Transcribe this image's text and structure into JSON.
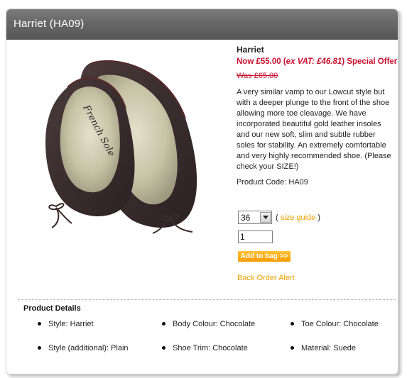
{
  "window": {
    "title": "Harriet (HA09)"
  },
  "product": {
    "name": "Harriet",
    "price_now_prefix": "Now £55.00 (",
    "price_vat": "ex VAT: £46.81",
    "price_now_suffix": ") Special Offer",
    "price_was": "Was £65.00",
    "description": "A very similar vamp to our Lowcut style but with a deeper plunge to the front of the shoe allowing more toe cleavage. We have incorporated beautiful gold leather insoles and our new soft, slim and subtle rubber soles for stability. An extremely comfortable and very highly recommended shoe. (Please check your SIZE!)",
    "code": "Product Code: HA09",
    "image_alt": "Harriet chocolate suede ballet flats",
    "insole_brand": "French Sole"
  },
  "purchase": {
    "size_value": "36",
    "size_guide_open": "( ",
    "size_guide_label": "size guide",
    "size_guide_close": " )",
    "quantity": "1",
    "add_label": "Add to bag >>",
    "back_order_label": "Back Order Alert"
  },
  "details": {
    "title": "Product Details",
    "items": [
      "Style: Harriet",
      "Body Colour: Chocolate",
      "Toe Colour: Chocolate",
      "Style (additional): Plain",
      "Shoe Trim: Chocolate",
      "Material: Suede"
    ]
  },
  "colors": {
    "accent": "#e8a000",
    "price": "#c8102e",
    "title_bar": "#666666"
  }
}
